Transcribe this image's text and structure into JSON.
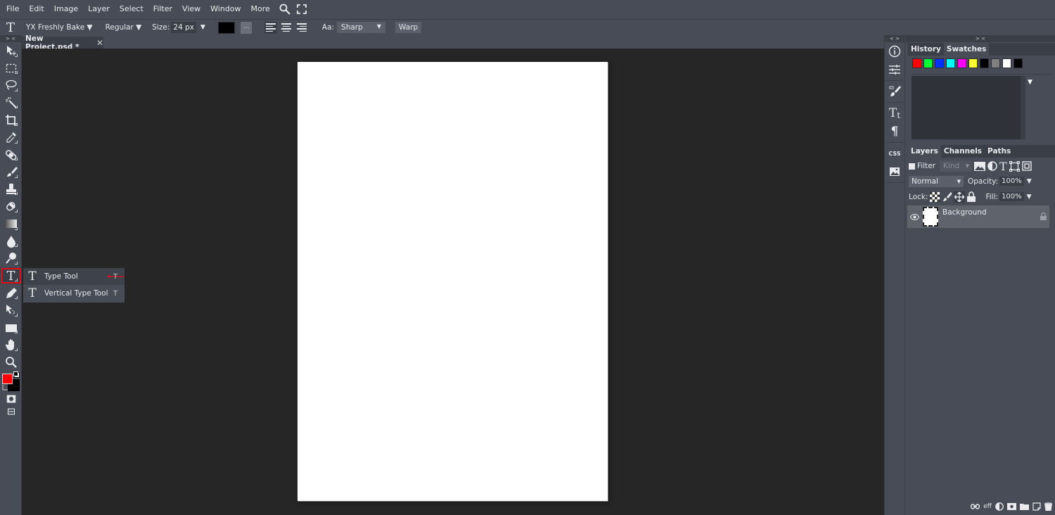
{
  "menu": {
    "items": [
      "File",
      "Edit",
      "Image",
      "Layer",
      "Select",
      "Filter",
      "View",
      "Window",
      "More"
    ],
    "icons": [
      "search-icon",
      "fullscreen-icon"
    ]
  },
  "options": {
    "tool_icon": "T",
    "font_family": "YX Freshly Bake",
    "font_style": "Regular",
    "size_label": "Size:",
    "size_value": "24 px",
    "text_color": "#000000",
    "more_label": "...",
    "align_options": [
      "align-left",
      "align-center",
      "align-right"
    ],
    "align_selected": "align-left",
    "aa_label": "Aa:",
    "aa_value": "Sharp",
    "warp_label": "Warp",
    "dropdown_arrow": "▼"
  },
  "document": {
    "tab_title": "New Project.psd *",
    "close_glyph": "✕",
    "canvas_color": "#ffffff"
  },
  "toolbar": {
    "collapse_glyph": "> <",
    "tools": [
      "move-tool",
      "marquee-tool",
      "lasso-tool",
      "magic-wand-tool",
      "crop-tool",
      "eyedropper-tool",
      "healing-tool",
      "brush-tool",
      "stamp-tool",
      "eraser-tool",
      "gradient-tool",
      "blur-tool",
      "dodge-tool",
      "type-tool",
      "pen-tool",
      "path-select-tool",
      "shape-tool",
      "hand-tool",
      "zoom-tool"
    ],
    "active_tool": "type-tool",
    "foreground_color": "#ff0000",
    "background_color": "#000000"
  },
  "flyout": {
    "items": [
      {
        "icon": "T",
        "label": "Type Tool",
        "shortcut": "T"
      },
      {
        "icon": "IT",
        "label": "Vertical Type Tool",
        "shortcut": "T"
      }
    ],
    "annotation_color": "#e3101a"
  },
  "midstrip": {
    "collapse_glyph": "< >",
    "icons": [
      "info-icon",
      "adjustments-icon",
      "brush-settings-icon",
      "character-icon",
      "paragraph-icon",
      "css-icon",
      "image-icon"
    ],
    "css_label": "CSS"
  },
  "right_panel": {
    "collapse_glyph": "> <",
    "top_tabs": [
      "History",
      "Swatches"
    ],
    "top_active": "Swatches",
    "swatches": [
      "#ff0000",
      "#00ff33",
      "#0033ff",
      "#00ffff",
      "#ff00ff",
      "#ffff33",
      "#000000",
      "#808080",
      "#ffffff",
      "#000000"
    ],
    "layer_tabs": [
      "Layers",
      "Channels",
      "Paths"
    ],
    "layer_active": "Layers",
    "filter_label": "Filter",
    "kind_placeholder": "Kind",
    "blend_mode": "Normal",
    "opacity_label": "Opacity:",
    "opacity_value": "100%",
    "lock_label": "Lock:",
    "fill_label": "Fill:",
    "fill_value": "100%",
    "layers": [
      {
        "name": "Background",
        "locked": true,
        "visible": true
      }
    ],
    "bottom_icons": [
      "link-icon",
      "effects-icon",
      "adjustment-layer-icon",
      "mask-icon",
      "folder-icon",
      "new-layer-icon",
      "trash-icon"
    ],
    "eff_label": "eff"
  }
}
